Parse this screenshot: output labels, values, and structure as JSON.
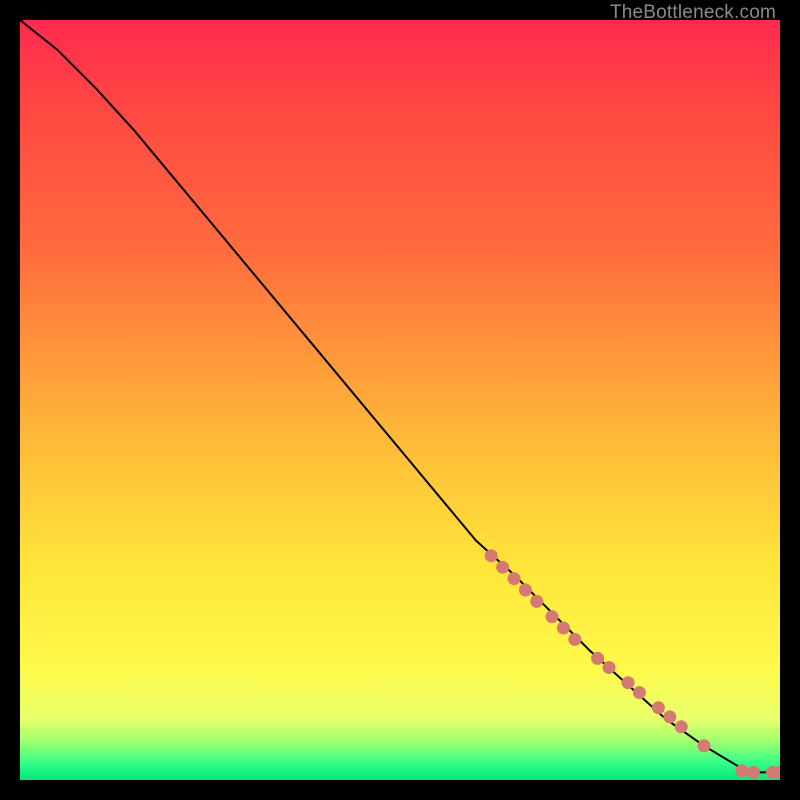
{
  "attribution": "TheBottleneck.com",
  "chart_data": {
    "type": "line",
    "title": "",
    "xlabel": "",
    "ylabel": "",
    "xlim": [
      0,
      100
    ],
    "ylim": [
      0,
      100
    ],
    "grid": false,
    "legend": false,
    "series": [
      {
        "name": "curve",
        "x": [
          0,
          5,
          10,
          15,
          20,
          25,
          30,
          35,
          40,
          45,
          50,
          55,
          60,
          65,
          70,
          75,
          80,
          85,
          90,
          95,
          97,
          99,
          100
        ],
        "y": [
          100,
          96,
          91,
          85.5,
          79.5,
          73.5,
          67.5,
          61.5,
          55.5,
          49.5,
          43.5,
          37.5,
          31.5,
          27,
          22,
          17,
          12.5,
          8,
          4.5,
          1.5,
          1.0,
          1.0,
          1.0
        ],
        "stroke": "#000000",
        "stroke_width": 2
      }
    ],
    "markers": [
      {
        "x": 62,
        "y": 29.5,
        "r": 6.5,
        "fill": "#d47a72"
      },
      {
        "x": 63.5,
        "y": 28,
        "r": 6.5,
        "fill": "#d47a72"
      },
      {
        "x": 65,
        "y": 26.5,
        "r": 6.5,
        "fill": "#d47a72"
      },
      {
        "x": 66.5,
        "y": 25,
        "r": 6.5,
        "fill": "#d47a72"
      },
      {
        "x": 68,
        "y": 23.5,
        "r": 6.5,
        "fill": "#d47a72"
      },
      {
        "x": 70,
        "y": 21.5,
        "r": 6.5,
        "fill": "#d47a72"
      },
      {
        "x": 71.5,
        "y": 20,
        "r": 6.5,
        "fill": "#d47a72"
      },
      {
        "x": 73,
        "y": 18.5,
        "r": 6.5,
        "fill": "#d47a72"
      },
      {
        "x": 76,
        "y": 16,
        "r": 6.5,
        "fill": "#d47a72"
      },
      {
        "x": 77.5,
        "y": 14.8,
        "r": 6.5,
        "fill": "#d47a72"
      },
      {
        "x": 80,
        "y": 12.8,
        "r": 6.5,
        "fill": "#d47a72"
      },
      {
        "x": 81.5,
        "y": 11.5,
        "r": 6.5,
        "fill": "#d47a72"
      },
      {
        "x": 84,
        "y": 9.5,
        "r": 6.5,
        "fill": "#d47a72"
      },
      {
        "x": 85.5,
        "y": 8.3,
        "r": 6.5,
        "fill": "#d47a72"
      },
      {
        "x": 87,
        "y": 7.0,
        "r": 6.5,
        "fill": "#d47a72"
      },
      {
        "x": 90,
        "y": 4.5,
        "r": 6.5,
        "fill": "#d47a72"
      },
      {
        "x": 95,
        "y": 1.2,
        "r": 6.5,
        "fill": "#d47a72"
      },
      {
        "x": 96.5,
        "y": 1.0,
        "r": 6.5,
        "fill": "#d47a72"
      },
      {
        "x": 99,
        "y": 1.0,
        "r": 6.5,
        "fill": "#d47a72"
      },
      {
        "x": 100,
        "y": 1.0,
        "r": 6.5,
        "fill": "#d47a72"
      }
    ]
  }
}
